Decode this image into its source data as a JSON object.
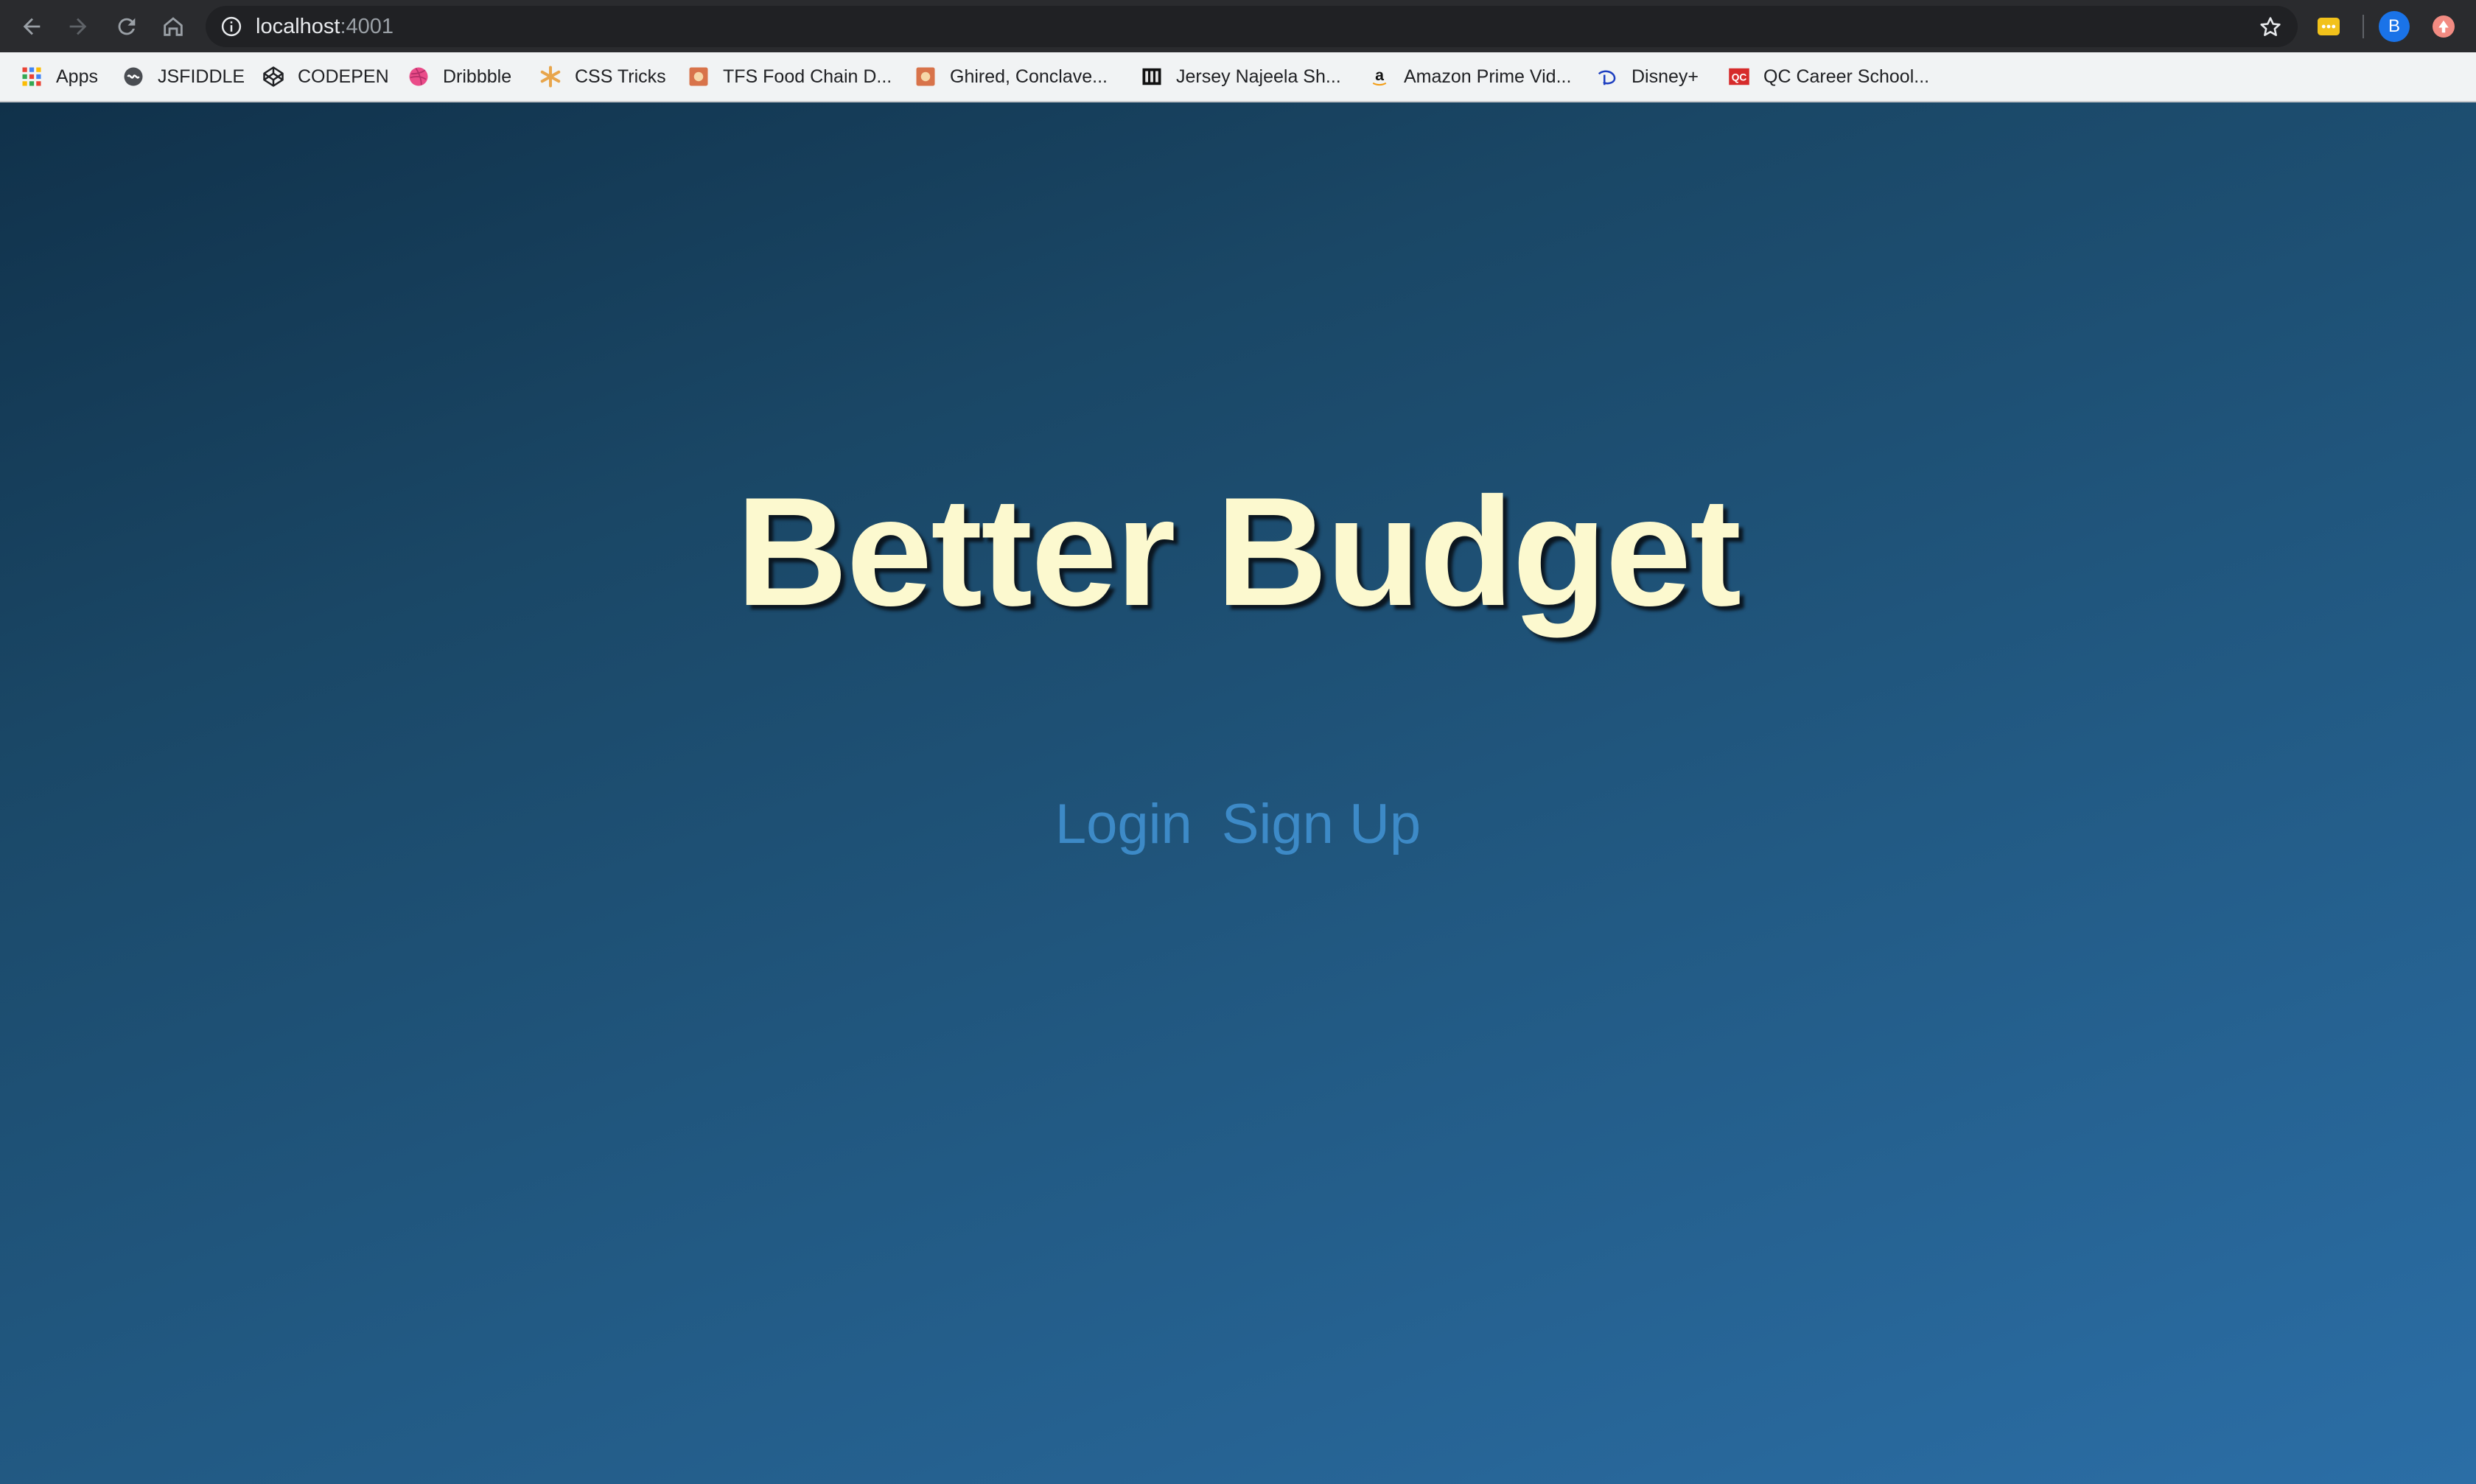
{
  "browser": {
    "url_host": "localhost",
    "url_port": ":4001",
    "profile_initial": "B",
    "bookmarks": [
      {
        "label": "Apps",
        "icon": "apps-grid-icon"
      },
      {
        "label": "JSFIDDLE",
        "icon": "jsfiddle-icon"
      },
      {
        "label": "CODEPEN",
        "icon": "codepen-icon"
      },
      {
        "label": "Dribbble",
        "icon": "dribbble-icon"
      },
      {
        "label": "CSS Tricks",
        "icon": "css-tricks-icon"
      },
      {
        "label": "TFS Food Chain D...",
        "icon": "tfs-icon"
      },
      {
        "label": "Ghired, Conclave...",
        "icon": "ghired-icon"
      },
      {
        "label": "Jersey Najeela Sh...",
        "icon": "jersey-icon"
      },
      {
        "label": "Amazon Prime Vid...",
        "icon": "amazon-icon"
      },
      {
        "label": "Disney+",
        "icon": "disney-icon"
      },
      {
        "label": "QC Career School...",
        "icon": "qc-icon"
      }
    ]
  },
  "page": {
    "title": "Better Budget",
    "login_label": "Login",
    "signup_label": "Sign Up"
  },
  "colors": {
    "title": "#fcf9cf",
    "link": "#3d8ac7",
    "background_top": "#10314a",
    "background_bottom": "#2b6ea6"
  }
}
